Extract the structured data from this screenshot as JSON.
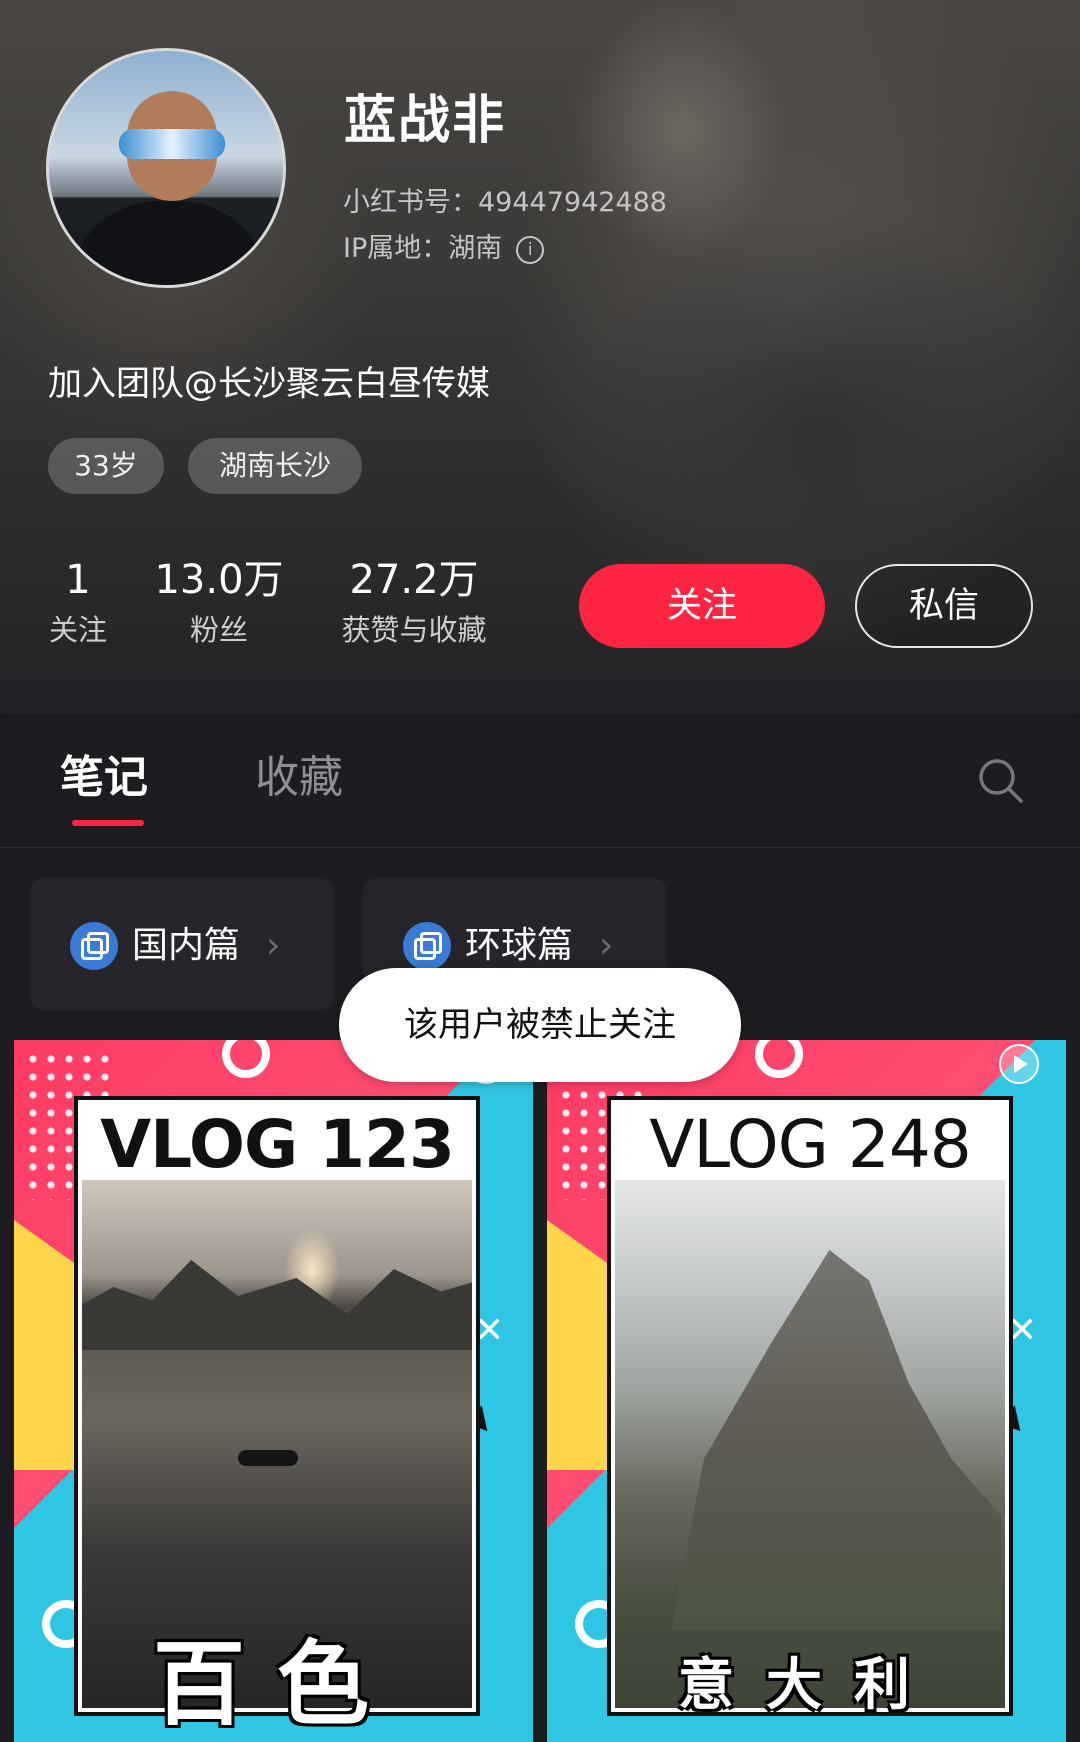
{
  "profile": {
    "name": "蓝战非",
    "id_line": "小红书号：49447942488",
    "ip_line": "IP属地：湖南",
    "bio": "加入团队@长沙聚云白昼传媒",
    "tags": [
      "33岁",
      "湖南长沙"
    ],
    "stats": [
      {
        "value": "1",
        "label": "关注"
      },
      {
        "value": "13.0万",
        "label": "粉丝"
      },
      {
        "value": "27.2万",
        "label": "获赞与收藏"
      }
    ],
    "follow_button": "关注",
    "message_button": "私信"
  },
  "tabs": {
    "notes": "笔记",
    "saved": "收藏"
  },
  "collections": [
    {
      "label": "国内篇"
    },
    {
      "label": "环球篇"
    }
  ],
  "notes": [
    {
      "title": "VLOG 123",
      "subtitle": "百色"
    },
    {
      "title": "VLOG 248",
      "subtitle": "意大利"
    }
  ],
  "toast": "该用户被禁止关注",
  "icons": {
    "info": "info-icon",
    "search": "search-icon",
    "collection": "collection-icon",
    "chevron": "chevron-right-icon",
    "play": "play-icon"
  },
  "colors": {
    "accent": "#ff2442",
    "background": "#1c1c21",
    "collection_icon": "#3a7bd5"
  }
}
